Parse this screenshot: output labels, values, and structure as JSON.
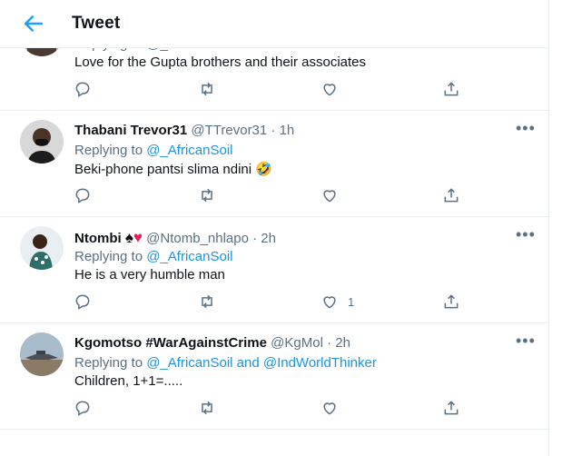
{
  "header": {
    "title": "Tweet"
  },
  "tweets": [
    {
      "partial_line": "Replying to @_AfricanSoil",
      "text": "Love for the Gupta brothers and their associates"
    },
    {
      "name": "Thabani Trevor31",
      "handle": "@TTrevor31",
      "sep": "·",
      "time": "1h",
      "replying_prefix": "Replying to",
      "reply_to": "@_AfricanSoil",
      "text": "Beki-phone pantsi slima ndini",
      "emoji": "🤣"
    },
    {
      "name": "Ntombi",
      "name_emojis": [
        "♠",
        "♥"
      ],
      "handle": "@Ntomb_nhlapo",
      "sep": "·",
      "time": "2h",
      "replying_prefix": "Replying to",
      "reply_to": "@_AfricanSoil",
      "text": "He is a very humble man",
      "like_count": "1"
    },
    {
      "name": "Kgomotso #WarAgainstCrime",
      "handle": "@KgMol",
      "sep": "·",
      "time": "2h",
      "replying_prefix": "Replying to",
      "reply_to": "@_AfricanSoil and @IndWorldThinker",
      "text": "Children, 1+1=....."
    }
  ],
  "icons": {
    "back": "arrow-left-icon",
    "reply": "reply-icon",
    "retweet": "retweet-icon",
    "like": "heart-icon",
    "share": "share-icon",
    "more": "more-icon"
  },
  "colors": {
    "accent": "#1da1f2",
    "link": "#1b95e0",
    "muted": "#5b7083",
    "border": "#ebeef0"
  }
}
